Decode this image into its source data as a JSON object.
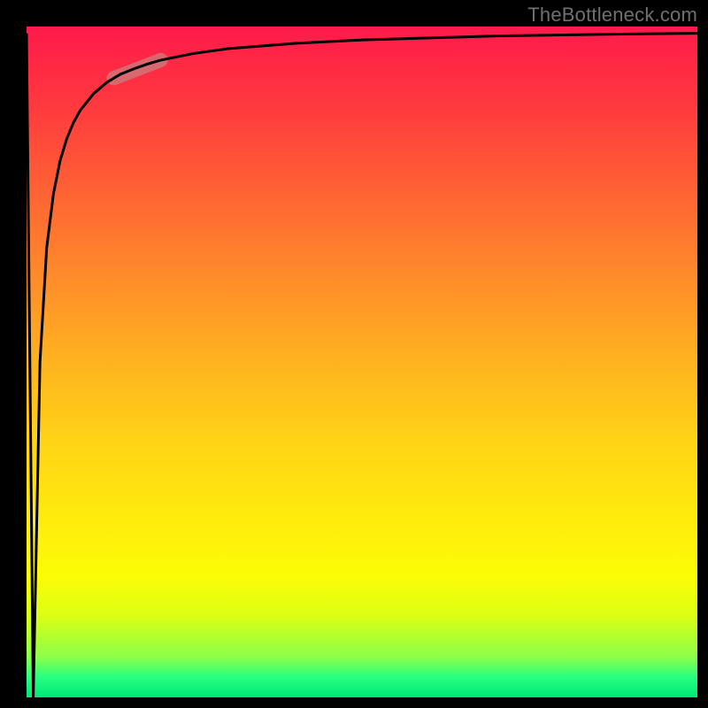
{
  "watermark": "TheBottleneck.com",
  "chart_data": {
    "type": "line",
    "title": "",
    "xlabel": "",
    "ylabel": "",
    "xlim": [
      0,
      100
    ],
    "ylim": [
      0,
      100
    ],
    "series": [
      {
        "name": "bottleneck-curve",
        "x": [
          0,
          1,
          2,
          3,
          4,
          5,
          6,
          7,
          8,
          10,
          12,
          14,
          16,
          18,
          20,
          25,
          30,
          40,
          50,
          60,
          70,
          80,
          90,
          100
        ],
        "y": [
          99,
          0,
          50,
          67,
          75,
          80,
          83.3,
          85.7,
          87.5,
          90,
          91.7,
          92.9,
          93.7,
          94.4,
          95,
          96,
          96.7,
          97.5,
          98,
          98.3,
          98.6,
          98.75,
          98.9,
          99
        ]
      }
    ],
    "highlight_range_x": [
      13,
      20
    ],
    "background_gradient": {
      "top": "#ff1a4d",
      "middle": "#ffee00",
      "bottom": "#00e676"
    }
  }
}
